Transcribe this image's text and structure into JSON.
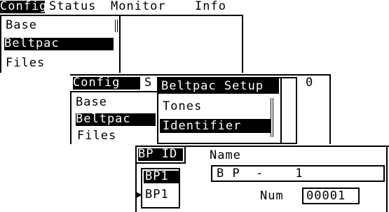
{
  "screen1": {
    "menu": [
      "Config",
      "Status",
      "Monitor",
      "Info"
    ],
    "items": [
      "Base",
      "Beltpac",
      "Files"
    ],
    "selected": "Beltpac"
  },
  "screen2": {
    "menu_active": "Config",
    "menu_next": "S",
    "items": [
      "Base",
      "Beltpac",
      "Files"
    ],
    "popup_title": "Beltpac Setup",
    "popup_items": [
      "Tones",
      "Identifier"
    ],
    "corner_value": "0"
  },
  "screen3": {
    "tab": "BP ID",
    "list": [
      "BP1",
      "BP1"
    ],
    "name_label": "Name",
    "name_value": "B P  -    1",
    "num_label": "Num",
    "num_value": "00001"
  },
  "colors": {
    "ink": "#000000",
    "paper": "#ffffff"
  }
}
